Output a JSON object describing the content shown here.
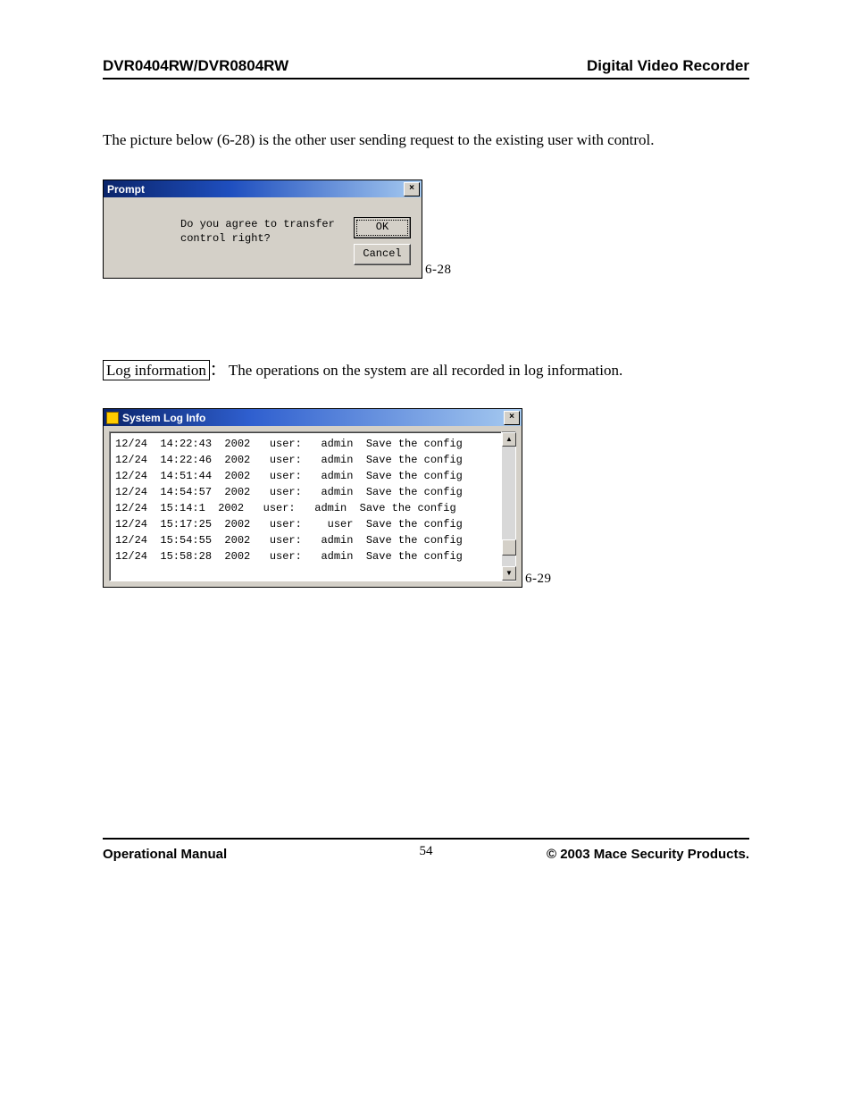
{
  "header": {
    "left": "DVR0404RW/DVR0804RW",
    "right": "Digital Video Recorder"
  },
  "intro_text": "The picture below (6-28) is the other user sending request to the existing user with control.",
  "prompt_window": {
    "title": "Prompt",
    "close_glyph": "×",
    "message": "Do you agree to transfer\ncontrol right?",
    "ok_label": "OK",
    "cancel_label": "Cancel"
  },
  "fig1_label": "6-28",
  "log_section": {
    "boxed_label": "Log information",
    "separator": "：",
    "rest": "The operations on the system are all recorded in log information."
  },
  "log_window": {
    "title": "System Log Info",
    "close_glyph": "×",
    "scroll_up_glyph": "▲",
    "scroll_down_glyph": "▼",
    "lines": [
      "12/24  14:22:43  2002   user:   admin  Save the config",
      "12/24  14:22:46  2002   user:   admin  Save the config",
      "12/24  14:51:44  2002   user:   admin  Save the config",
      "12/24  14:54:57  2002   user:   admin  Save the config",
      "12/24  15:14:1  2002   user:   admin  Save the config",
      "12/24  15:17:25  2002   user:    user  Save the config",
      "12/24  15:54:55  2002   user:   admin  Save the config",
      "12/24  15:58:28  2002   user:   admin  Save the config"
    ]
  },
  "fig2_label": "6-29",
  "footer": {
    "left": "Operational Manual",
    "page": "54",
    "right": "© 2003 Mace Security Products."
  }
}
